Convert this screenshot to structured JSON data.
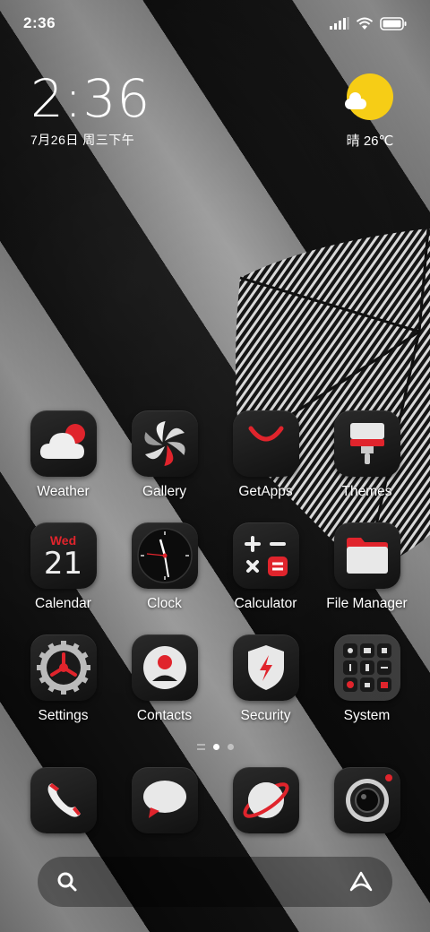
{
  "status_bar": {
    "time": "2:36",
    "icons": [
      "signal-icon",
      "wifi-icon",
      "battery-icon"
    ]
  },
  "clock_widget": {
    "time": "2:36",
    "date": "7月26日 周三下午"
  },
  "weather_widget": {
    "condition": "晴",
    "temperature": "26℃",
    "icon": "sun-cloud-icon",
    "sun_color": "#f6cd16"
  },
  "apps": [
    {
      "label": "Weather",
      "icon": "weather-icon"
    },
    {
      "label": "Gallery",
      "icon": "gallery-icon"
    },
    {
      "label": "GetApps",
      "icon": "getapps-icon"
    },
    {
      "label": "Themes",
      "icon": "themes-icon"
    },
    {
      "label": "Calendar",
      "icon": "calendar-icon",
      "day_name": "Wed",
      "day_number": "21"
    },
    {
      "label": "Clock",
      "icon": "clock-icon"
    },
    {
      "label": "Calculator",
      "icon": "calculator-icon"
    },
    {
      "label": "File Manager",
      "icon": "file-manager-icon"
    },
    {
      "label": "Settings",
      "icon": "settings-icon"
    },
    {
      "label": "Contacts",
      "icon": "contacts-icon"
    },
    {
      "label": "Security",
      "icon": "security-icon"
    },
    {
      "label": "System",
      "icon": "system-folder-icon"
    }
  ],
  "page_indicator": {
    "pages": 2,
    "active": 1
  },
  "dock": [
    {
      "icon": "phone-icon"
    },
    {
      "icon": "messages-icon"
    },
    {
      "icon": "browser-icon"
    },
    {
      "icon": "camera-icon"
    }
  ],
  "search_bar": {
    "icons": [
      "search-icon",
      "assistant-icon"
    ]
  },
  "colors": {
    "accent": "#e0242c",
    "icon_bg": "#1c1c1c"
  }
}
